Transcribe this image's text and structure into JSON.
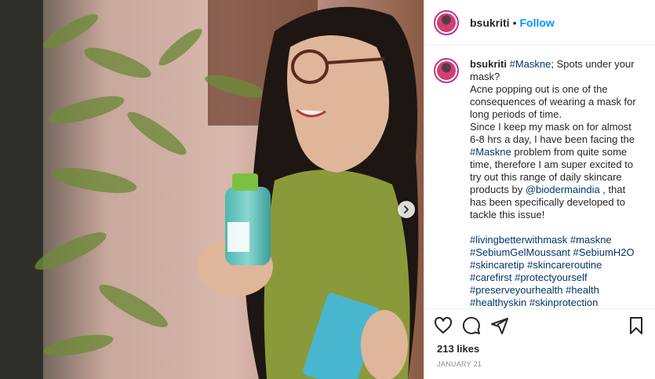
{
  "header": {
    "username": "bsukriti",
    "separator": "•",
    "follow_label": "Follow"
  },
  "caption": {
    "username": "bsukriti",
    "tag_maskne_1": "#Maskne",
    "text_1": "; Spots under your mask?",
    "text_2": "Acne popping out is one of the consequences of wearing a mask for long periods of time.",
    "text_3": "Since I keep my mask on for almost 6-8 hrs a day, I have been facing the ",
    "tag_maskne_2": "#Maskne",
    "text_4": " problem from quite some time, therefore I am super excited to try out this range of daily skincare products by ",
    "mention": "@biodermaindia",
    "text_5": " , that has been specifically developed to tackle this issue!",
    "hashtags": [
      "#livingbetterwithmask",
      "#maskne",
      "#SebiumGelMoussant",
      "#SebiumH2O",
      "#skincaretip",
      "#skincareroutine",
      "#carefirst",
      "#protectyourself",
      "#preserveyourhealth",
      "#health",
      "#healthyskin",
      "#skinprotection"
    ]
  },
  "likes": "213 likes",
  "date": "JANUARY 21",
  "icons": [
    "heart-icon",
    "comment-icon",
    "share-icon",
    "bookmark-icon",
    "chevron-right-icon"
  ],
  "colors": {
    "follow": "#0095f6",
    "link": "#00376b",
    "avatar_ring": "#c13584",
    "date": "#8e8e8e"
  }
}
